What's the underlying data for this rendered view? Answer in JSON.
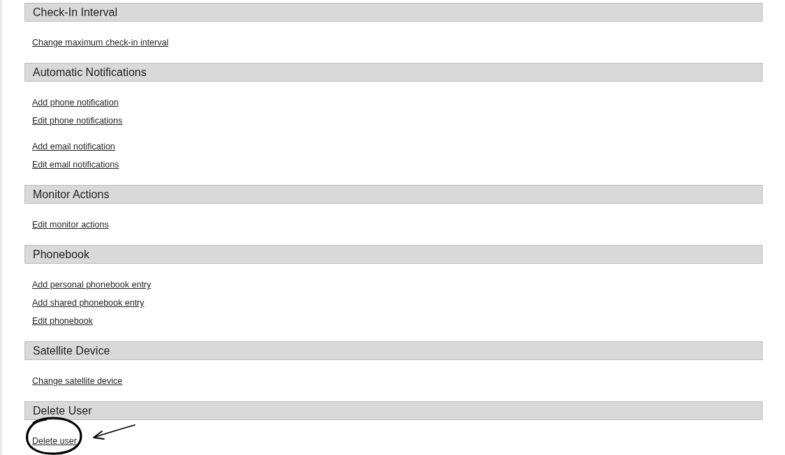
{
  "sections": [
    {
      "title": "Check-In Interval",
      "groups": [
        {
          "links": [
            {
              "label": "Change maximum check-in interval",
              "annotated": false
            }
          ]
        }
      ]
    },
    {
      "title": "Automatic Notifications",
      "groups": [
        {
          "links": [
            {
              "label": "Add phone notification",
              "annotated": false
            },
            {
              "label": "Edit phone notifications",
              "annotated": false
            }
          ]
        },
        {
          "links": [
            {
              "label": "Add email notification",
              "annotated": false
            },
            {
              "label": "Edit email notifications",
              "annotated": false
            }
          ]
        }
      ]
    },
    {
      "title": "Monitor Actions",
      "groups": [
        {
          "links": [
            {
              "label": "Edit monitor actions",
              "annotated": false
            }
          ]
        }
      ]
    },
    {
      "title": "Phonebook",
      "groups": [
        {
          "links": [
            {
              "label": "Add personal phonebook entry",
              "annotated": false
            },
            {
              "label": "Add shared phonebook entry",
              "annotated": false
            },
            {
              "label": "Edit phonebook",
              "annotated": false
            }
          ]
        }
      ]
    },
    {
      "title": "Satellite Device",
      "groups": [
        {
          "links": [
            {
              "label": "Change satellite device",
              "annotated": false
            }
          ]
        }
      ]
    },
    {
      "title": "Delete User",
      "groups": [
        {
          "links": [
            {
              "label": "Delete user",
              "annotated": true
            }
          ]
        }
      ]
    }
  ]
}
